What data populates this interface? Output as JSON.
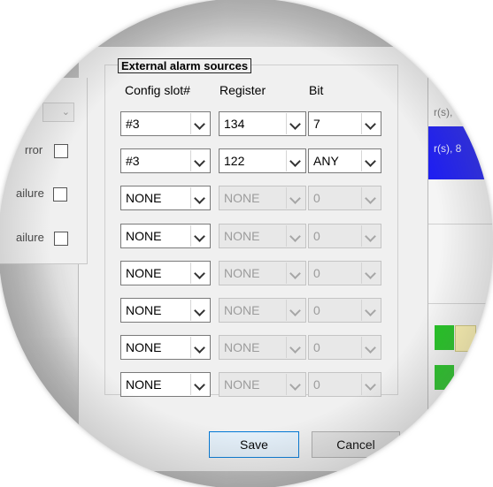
{
  "left_pane": {
    "row1_label": "rror",
    "row2_label": "ailure",
    "row3_label": "ailure"
  },
  "group": {
    "title": "External alarm sources",
    "headers": {
      "slot": "Config slot#",
      "register": "Register",
      "bit": "Bit"
    },
    "rows": [
      {
        "slot": "#3",
        "register": "134",
        "bit": "7",
        "enabled": true
      },
      {
        "slot": "#3",
        "register": "122",
        "bit": "ANY",
        "enabled": true
      },
      {
        "slot": "NONE",
        "register": "NONE",
        "bit": "0",
        "enabled": false
      },
      {
        "slot": "NONE",
        "register": "NONE",
        "bit": "0",
        "enabled": false
      },
      {
        "slot": "NONE",
        "register": "NONE",
        "bit": "0",
        "enabled": false
      },
      {
        "slot": "NONE",
        "register": "NONE",
        "bit": "0",
        "enabled": false
      },
      {
        "slot": "NONE",
        "register": "NONE",
        "bit": "0",
        "enabled": false
      },
      {
        "slot": "NONE",
        "register": "NONE",
        "bit": "0",
        "enabled": false
      }
    ]
  },
  "right_pane": {
    "text1": "r(s),",
    "text2": "r(s), 8"
  },
  "buttons": {
    "save": "Save",
    "cancel": "Cancel"
  },
  "colors": {
    "blue_bar": "#1f1ff0",
    "green": "#22c322",
    "yellow": "#fff4b0",
    "focus_border": "#0078d7"
  }
}
